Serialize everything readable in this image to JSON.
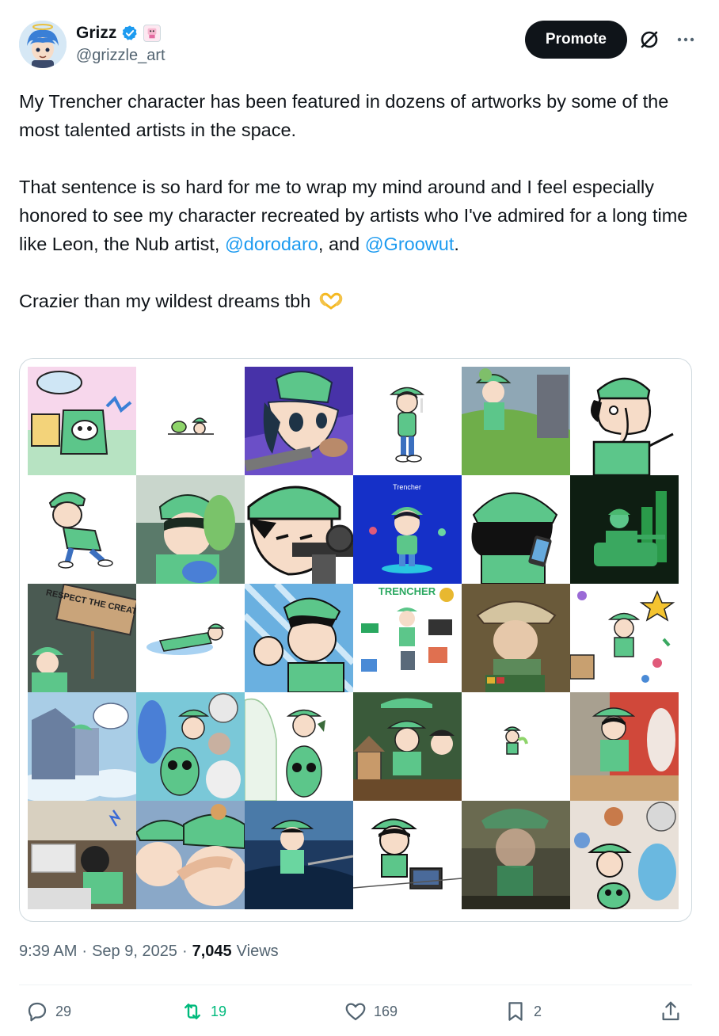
{
  "author": {
    "display_name": "Grizz",
    "handle": "@grizzle_art"
  },
  "header": {
    "promote_label": "Promote"
  },
  "tweet": {
    "paragraph1": "My Trencher character has been featured in dozens of artworks by some of the most talented artists in the space.",
    "paragraph2_text": "That sentence is so hard for me to wrap my mind around and I feel especially honored to see my character recreated by artists who I've admired for a long time like Leon, the Nub artist, ",
    "mention1": "@dorodaro",
    "between_mentions": ", and ",
    "mention2": "@Groowut",
    "after_mention2": ".",
    "paragraph3": "Crazier than my wildest dreams tbh"
  },
  "media": {
    "tile_texts": {
      "respect_sign": "RESPECT THE CREATOR",
      "trencher_title": "Trencher",
      "trencher_poster": "TRENCHER"
    }
  },
  "meta": {
    "time": "9:39 AM",
    "sep1": "·",
    "date": "Sep 9, 2025",
    "sep2": "·",
    "views_count": "7,045",
    "views_label": "Views"
  },
  "actions": {
    "replies": "29",
    "reposts": "19",
    "likes": "169",
    "bookmarks": "2"
  },
  "colors": {
    "accent": "#1d9bf0",
    "repost_green": "#00ba7c",
    "text": "#0f1419",
    "muted": "#536471",
    "helmet_green": "#5cc68a"
  }
}
